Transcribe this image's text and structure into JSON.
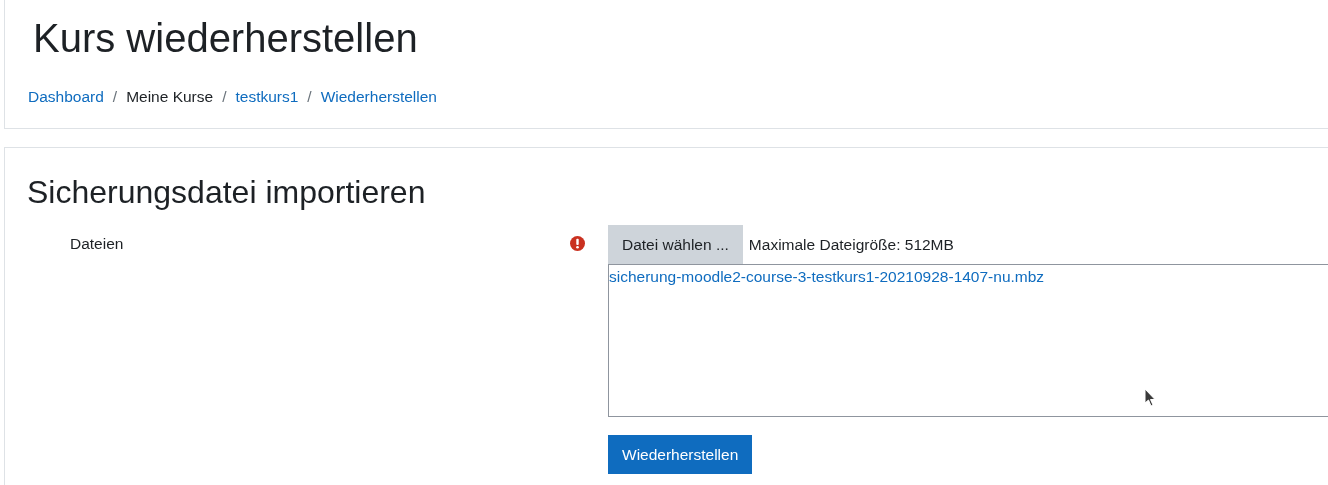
{
  "page_title": "Kurs wiederherstellen",
  "breadcrumb": [
    {
      "label": "Dashboard",
      "link": true
    },
    {
      "label": "Meine Kurse",
      "link": false
    },
    {
      "label": "testkurs1",
      "link": true
    },
    {
      "label": "Wiederherstellen",
      "link": true
    }
  ],
  "breadcrumb_separator": "/",
  "section_title": "Sicherungsdatei importieren",
  "field": {
    "label": "Dateien",
    "required": true,
    "choose_button": "Datei wählen ...",
    "max_size": "Maximale Dateigröße: 512MB",
    "files": [
      "sicherung-moodle2-course-3-testkurs1-20210928-1407-nu.mbz"
    ]
  },
  "submit_button": "Wiederherstellen"
}
